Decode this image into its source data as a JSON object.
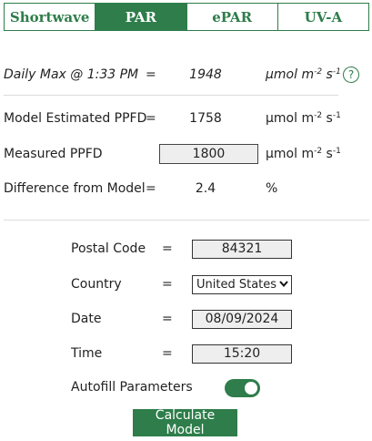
{
  "tabs": [
    {
      "label": "Shortwave",
      "active": false
    },
    {
      "label": "PAR",
      "active": true
    },
    {
      "label": "ePAR",
      "active": false
    },
    {
      "label": "UV-A",
      "active": false
    }
  ],
  "daily_max": {
    "label": "Daily Max @ 1:33 PM",
    "eq": "=",
    "value": "1948",
    "unit_base": "µmol m",
    "unit_exp1": "-2",
    "unit_mid": " s",
    "unit_exp2": "-1",
    "help_icon": "?"
  },
  "model_ppfd": {
    "label": "Model Estimated PPFD",
    "eq": "=",
    "value": "1758",
    "unit_base": "µmol m",
    "unit_exp1": "-2",
    "unit_mid": " s",
    "unit_exp2": "-1"
  },
  "measured_ppfd": {
    "label": "Measured PPFD",
    "value": "1800",
    "unit_base": "µmol m",
    "unit_exp1": "-2",
    "unit_mid": " s",
    "unit_exp2": "-1"
  },
  "difference": {
    "label": "Difference from Model",
    "eq": "=",
    "value": "2.4",
    "unit": "%"
  },
  "form": {
    "postal_code": {
      "label": "Postal Code",
      "eq": "=",
      "value": "84321"
    },
    "country": {
      "label": "Country",
      "eq": "=",
      "value": "United States"
    },
    "date": {
      "label": "Date",
      "eq": "=",
      "value": "08/09/2024"
    },
    "time": {
      "label": "Time",
      "eq": "=",
      "value": "15:20"
    },
    "autofill": {
      "label": "Autofill Parameters",
      "on": true
    }
  },
  "calculate_label": "Calculate Model",
  "colors": {
    "accent": "#2e7d4a"
  }
}
